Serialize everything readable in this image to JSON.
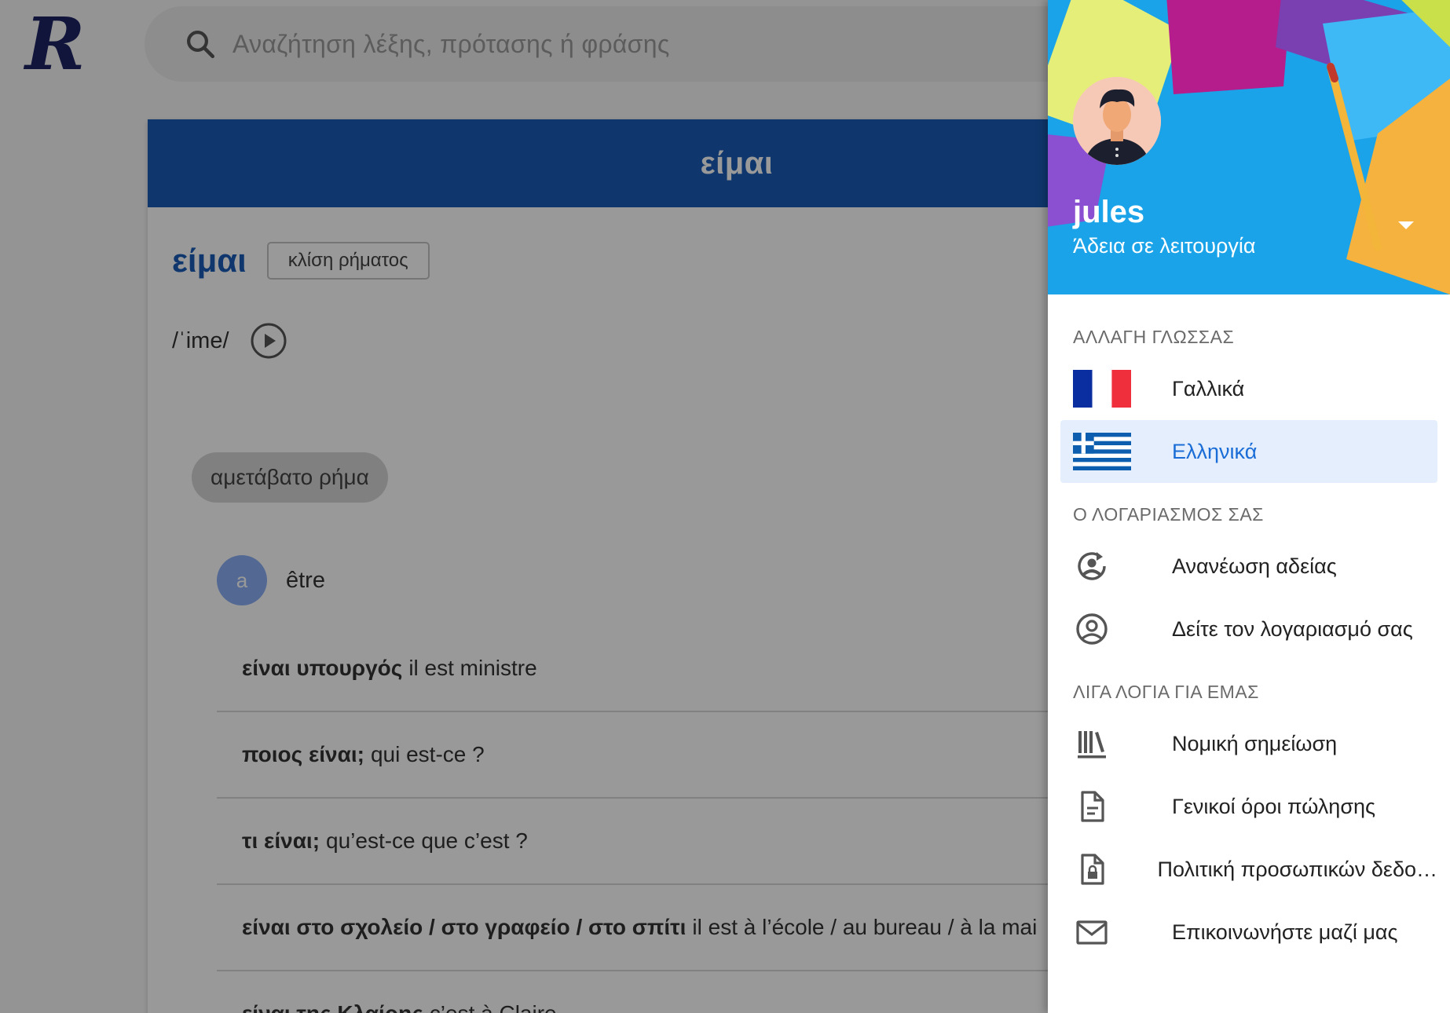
{
  "search": {
    "placeholder": "Αναζήτηση λέξης, πρότασης ή φράσης"
  },
  "entry": {
    "header_title": "είμαι",
    "headword": "είμαι",
    "conjugation_label": "κλίση ρήματος",
    "phonetic": "/ˈime/",
    "grammar_chip": "αμετάβατο ρήμα",
    "sense": {
      "marker": "a",
      "translation": "être"
    },
    "examples": [
      {
        "greek": "είναι υπουργός",
        "french": "il est ministre"
      },
      {
        "greek": "ποιος είναι;",
        "french": "qui est-ce ?"
      },
      {
        "greek": "τι είναι;",
        "french": "qu’est-ce que c’est ?"
      },
      {
        "greek": "είναι στο σχολείο / στο γραφείο / στο σπίτι",
        "french": "il est à l’école / au bureau / à la mai"
      },
      {
        "greek": "είναι της Κλαίρης",
        "french": "c’est à Claire"
      }
    ]
  },
  "drawer": {
    "user_name": "jules",
    "user_status": "Άδεια σε λειτουργία",
    "sections": {
      "language": "ΑΛΛΑΓΗ ΓΛΩΣΣΑΣ",
      "account": "Ο ΛΟΓΑΡΙΑΣΜΟΣ ΣΑΣ",
      "about": "ΛΙΓΑ ΛΟΓΙΑ ΓΙΑ ΕΜΑΣ"
    },
    "languages": [
      {
        "label": "Γαλλικά",
        "icon": "flag-france",
        "active": false
      },
      {
        "label": "Ελληνικά",
        "icon": "flag-greece",
        "active": true
      }
    ],
    "account_items": [
      {
        "label": "Ανανέωση αδείας",
        "icon": "renew-license-icon"
      },
      {
        "label": "Δείτε τον λογαριασμό σας",
        "icon": "account-circle-icon"
      }
    ],
    "about_items": [
      {
        "label": "Νομική σημείωση",
        "icon": "library-books-icon"
      },
      {
        "label": "Γενικοί όροι πώλησης",
        "icon": "document-icon"
      },
      {
        "label": "Πολιτική προσωπικών δεδο…",
        "icon": "document-lock-icon"
      },
      {
        "label": "Επικοινωνήστε μαζί μας",
        "icon": "mail-icon"
      }
    ]
  },
  "colors": {
    "accent": "#1a5db6",
    "active_bg": "#e4eefc",
    "active_text": "#1a6dd6"
  }
}
